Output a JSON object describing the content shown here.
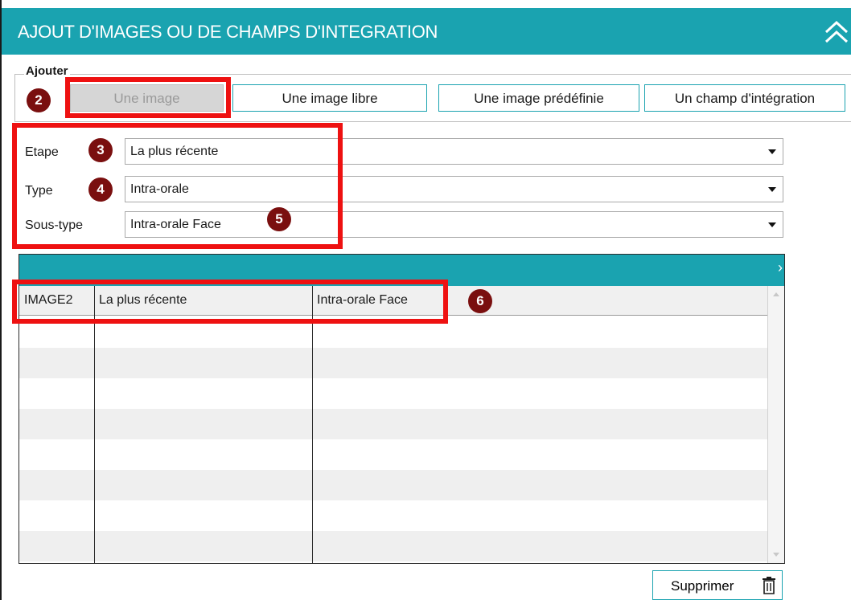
{
  "header": {
    "title": "AJOUT D'IMAGES OU DE CHAMPS D'INTEGRATION",
    "collapse_icon": "double-chevron-up-icon"
  },
  "add_group": {
    "legend": "Ajouter",
    "buttons": [
      {
        "label": "Une image",
        "state": "disabled"
      },
      {
        "label": "Une image libre"
      },
      {
        "label": "Une image prédéfinie"
      },
      {
        "label": "Un champ d'intégration"
      }
    ]
  },
  "filters": {
    "etape": {
      "label": "Etape",
      "value": "La plus récente"
    },
    "type": {
      "label": "Type",
      "value": "Intra-orale"
    },
    "sous_type": {
      "label": "Sous-type",
      "value": "Intra-orale Face"
    }
  },
  "grid": {
    "next_icon": "chevron-right-icon",
    "header_row": [
      "IMAGE2",
      "La plus récente",
      "Intra-orale Face"
    ]
  },
  "footer": {
    "delete_label": "Supprimer",
    "delete_icon": "trash-icon"
  },
  "annotations": [
    "2",
    "3",
    "4",
    "5",
    "6"
  ],
  "colors": {
    "accent": "#1aa3b0",
    "highlight": "#ee1111",
    "badge": "#7a0f0f",
    "disabled_bg": "#d6d6d6"
  }
}
